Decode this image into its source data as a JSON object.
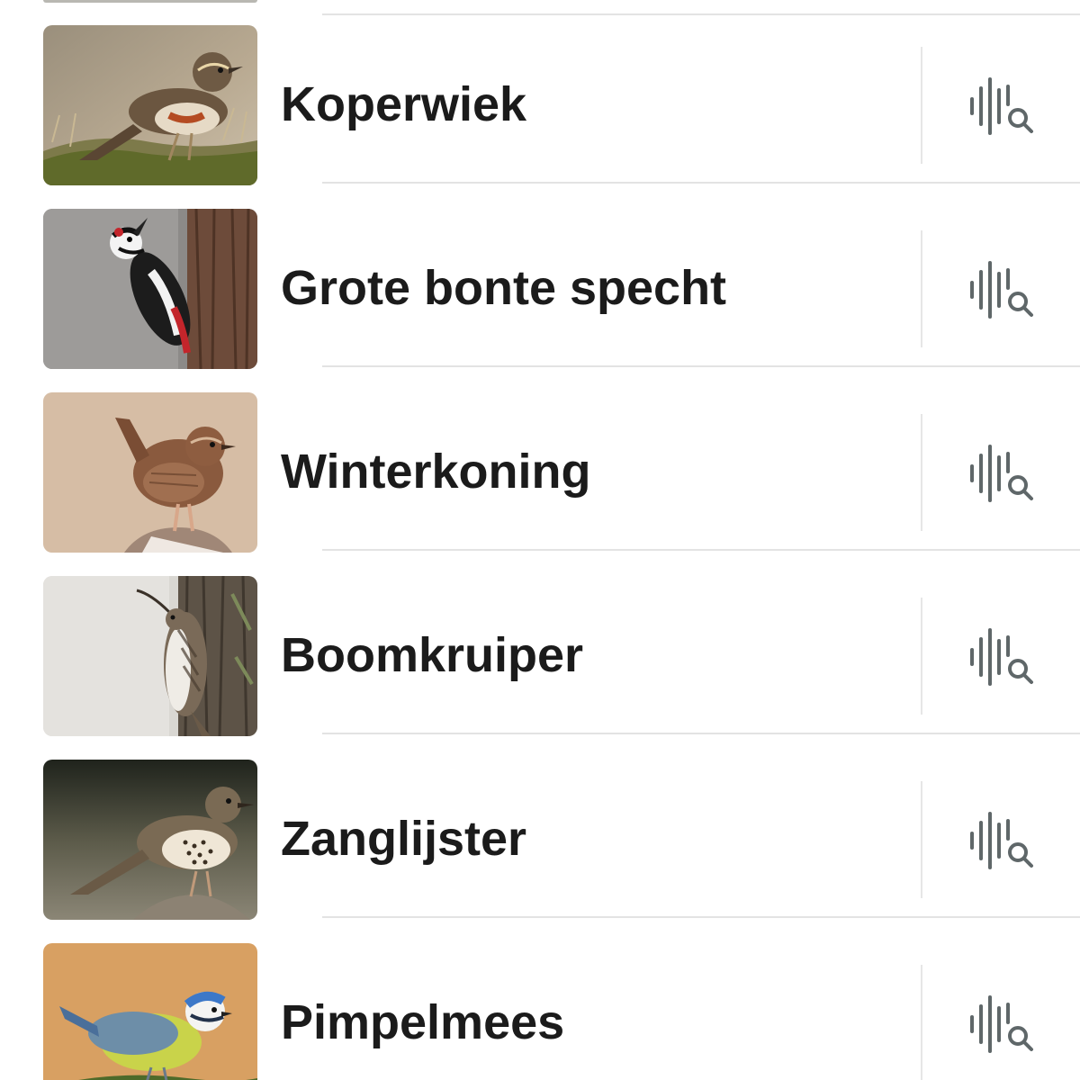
{
  "colors": {
    "text": "#1b1b1b",
    "icon": "#5f6769",
    "separator": "#e3e3e3",
    "background": "#ffffff"
  },
  "birds": [
    {
      "name": "Koperwiek",
      "photo_icon": "redwing-photo",
      "action_icon": "sound-search-icon"
    },
    {
      "name": "Grote bonte specht",
      "photo_icon": "great-spotted-woodpecker-photo",
      "action_icon": "sound-search-icon"
    },
    {
      "name": "Winterkoning",
      "photo_icon": "wren-photo",
      "action_icon": "sound-search-icon"
    },
    {
      "name": "Boomkruiper",
      "photo_icon": "treecreeper-photo",
      "action_icon": "sound-search-icon"
    },
    {
      "name": "Zanglijster",
      "photo_icon": "song-thrush-photo",
      "action_icon": "sound-search-icon"
    },
    {
      "name": "Pimpelmees",
      "photo_icon": "blue-tit-photo",
      "action_icon": "sound-search-icon"
    }
  ]
}
